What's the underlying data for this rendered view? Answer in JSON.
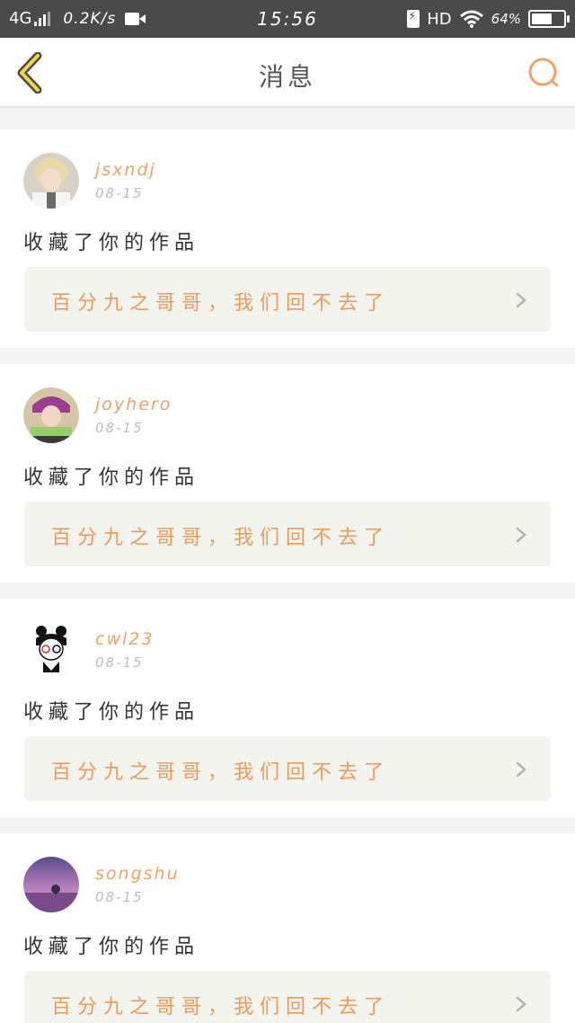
{
  "status_bar": {
    "network": "4G",
    "speed": "0.2K/s",
    "time": "15:56",
    "hd": "HD",
    "battery_pct": "64%",
    "battery_level": 0.64
  },
  "nav": {
    "title": "消息",
    "back_icon": "back-chevron-icon",
    "search_icon": "search-icon",
    "accent": "#f0a266"
  },
  "messages": [
    {
      "username": "jsxndj",
      "date": "08-15",
      "action": "收藏了你的作品",
      "work_title": "百分九之哥哥，我们回不去了"
    },
    {
      "username": "joyhero",
      "date": "08-15",
      "action": "收藏了你的作品",
      "work_title": "百分九之哥哥，我们回不去了"
    },
    {
      "username": "cwl23",
      "date": "08-15",
      "action": "收藏了你的作品",
      "work_title": "百分九之哥哥，我们回不去了"
    },
    {
      "username": "songshu",
      "date": "08-15",
      "action": "收藏了你的作品",
      "work_title": "百分九之哥哥，我们回不去了"
    }
  ]
}
